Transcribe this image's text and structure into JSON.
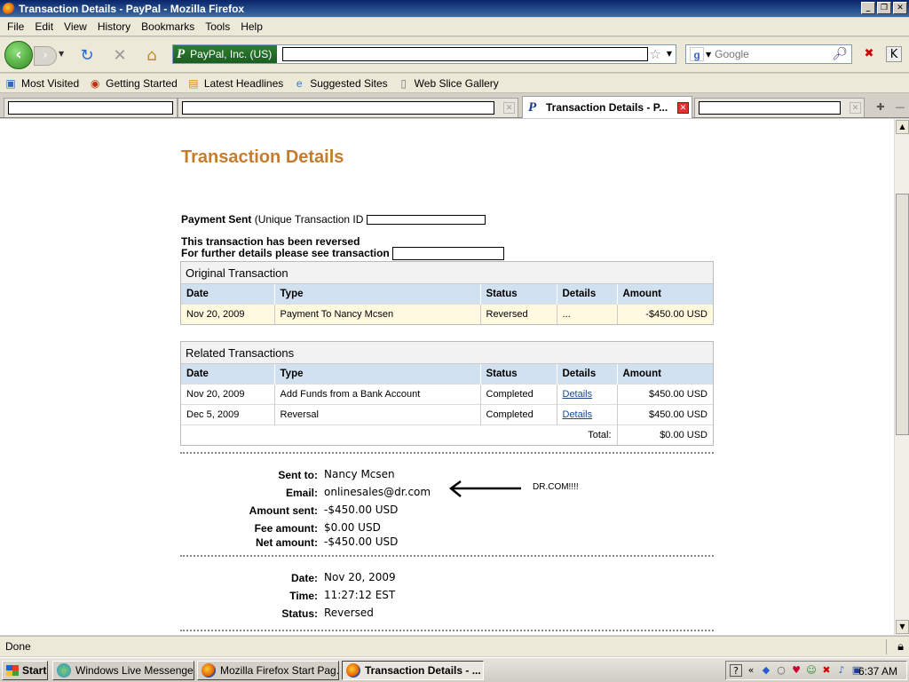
{
  "window": {
    "title": "Transaction Details - PayPal - Mozilla Firefox",
    "minimize": "_",
    "restore": "❐",
    "close": "✕"
  },
  "menu": [
    "File",
    "Edit",
    "View",
    "History",
    "Bookmarks",
    "Tools",
    "Help"
  ],
  "navbar": {
    "site_identity": "PayPal, Inc. (US)",
    "site_identity_logo": "P",
    "search_placeholder": "Google",
    "search_engine_logo": "g"
  },
  "bookmarks": [
    {
      "label": "Most Visited",
      "icon": "most-visited-icon"
    },
    {
      "label": "Getting Started",
      "icon": "firefox-icon"
    },
    {
      "label": "Latest Headlines",
      "icon": "rss-icon"
    },
    {
      "label": "Suggested Sites",
      "icon": "ie-icon"
    },
    {
      "label": "Web Slice Gallery",
      "icon": "page-icon"
    }
  ],
  "tabs": {
    "active_label": "Transaction Details - P...",
    "active_logo": "P"
  },
  "page": {
    "title": "Transaction Details",
    "payment_sent": "Payment Sent",
    "unique_id_label": "(Unique Transaction ID",
    "reversed_notice": "This transaction has been reversed",
    "further_details": "For further details please see transaction",
    "original": {
      "caption": "Original Transaction",
      "headers": [
        "Date",
        "Type",
        "Status",
        "Details",
        "Amount"
      ],
      "rows": [
        {
          "date": "Nov 20, 2009",
          "type": "Payment To Nancy Mcsen",
          "status": "Reversed",
          "details": "...",
          "amount": "-$450.00 USD"
        }
      ]
    },
    "related": {
      "caption": "Related Transactions",
      "headers": [
        "Date",
        "Type",
        "Status",
        "Details",
        "Amount"
      ],
      "rows": [
        {
          "date": "Nov 20, 2009",
          "type": "Add Funds from a Bank Account",
          "status": "Completed",
          "details": "Details",
          "amount": "$450.00 USD"
        },
        {
          "date": "Dec 5, 2009",
          "type": "Reversal",
          "status": "Completed",
          "details": "Details",
          "amount": "$450.00 USD"
        }
      ],
      "total_label": "Total:",
      "total_value": "$0.00 USD"
    },
    "summary": {
      "sent_to_label": "Sent to:",
      "sent_to": "Nancy Mcsen",
      "email_label": "Email:",
      "email": "onlinesales@dr.com",
      "amount_sent_label": "Amount sent:",
      "amount_sent": "-$450.00 USD",
      "fee_label": "Fee amount:",
      "fee": "$0.00 USD",
      "net_label": "Net amount:",
      "net": "-$450.00 USD"
    },
    "annotation": "DR.COM!!!!",
    "meta": {
      "date_label": "Date:",
      "date": "Nov 20, 2009",
      "time_label": "Time:",
      "time": "11:27:12 EST",
      "status_label": "Status:",
      "status": "Reversed"
    }
  },
  "statusbar": {
    "text": "Done"
  },
  "taskbar": {
    "start": "Start",
    "buttons": [
      {
        "label": "Windows Live Messenger"
      },
      {
        "label": "Mozilla Firefox Start Pag..."
      },
      {
        "label": "Transaction Details - ..."
      }
    ],
    "clock": "6:37 AM"
  }
}
